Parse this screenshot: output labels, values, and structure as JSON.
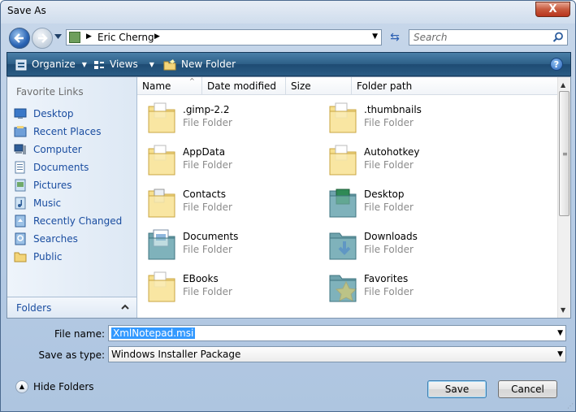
{
  "window": {
    "title": "Save As",
    "close_label": "X"
  },
  "address": {
    "path_segment": "Eric Cherng"
  },
  "search": {
    "placeholder": "Search"
  },
  "toolbar": {
    "organize_label": "Organize",
    "views_label": "Views",
    "new_folder_label": "New Folder",
    "help_label": "?"
  },
  "nav": {
    "favorite_links_heading": "Favorite Links",
    "items": [
      {
        "label": "Desktop",
        "icon": "desktop-icon"
      },
      {
        "label": "Recent Places",
        "icon": "recent-places-icon"
      },
      {
        "label": "Computer",
        "icon": "computer-icon"
      },
      {
        "label": "Documents",
        "icon": "documents-icon"
      },
      {
        "label": "Pictures",
        "icon": "pictures-icon"
      },
      {
        "label": "Music",
        "icon": "music-icon"
      },
      {
        "label": "Recently Changed",
        "icon": "recently-changed-icon"
      },
      {
        "label": "Searches",
        "icon": "searches-icon"
      },
      {
        "label": "Public",
        "icon": "public-icon"
      }
    ],
    "folders_label": "Folders"
  },
  "columns": [
    "Name",
    "Date modified",
    "Size",
    "Folder path"
  ],
  "files": [
    {
      "name": ".gimp-2.2",
      "type": "File Folder",
      "icon": "folder-icon"
    },
    {
      "name": ".thumbnails",
      "type": "File Folder",
      "icon": "folder-icon"
    },
    {
      "name": "AppData",
      "type": "File Folder",
      "icon": "folder-icon"
    },
    {
      "name": "Autohotkey",
      "type": "File Folder",
      "icon": "folder-icon"
    },
    {
      "name": "Contacts",
      "type": "File Folder",
      "icon": "contacts-folder-icon"
    },
    {
      "name": "Desktop",
      "type": "File Folder",
      "icon": "desktop-folder-icon"
    },
    {
      "name": "Documents",
      "type": "File Folder",
      "icon": "documents-folder-icon"
    },
    {
      "name": "Downloads",
      "type": "File Folder",
      "icon": "downloads-folder-icon"
    },
    {
      "name": "EBooks",
      "type": "File Folder",
      "icon": "folder-icon"
    },
    {
      "name": "Favorites",
      "type": "File Folder",
      "icon": "favorites-folder-icon"
    }
  ],
  "form": {
    "file_name_label": "File name:",
    "file_name_value": "XmlNotepad.msi",
    "save_type_label": "Save as type:",
    "save_type_value": "Windows Installer Package"
  },
  "footer": {
    "hide_folders_label": "Hide Folders",
    "save_label": "Save",
    "cancel_label": "Cancel"
  }
}
